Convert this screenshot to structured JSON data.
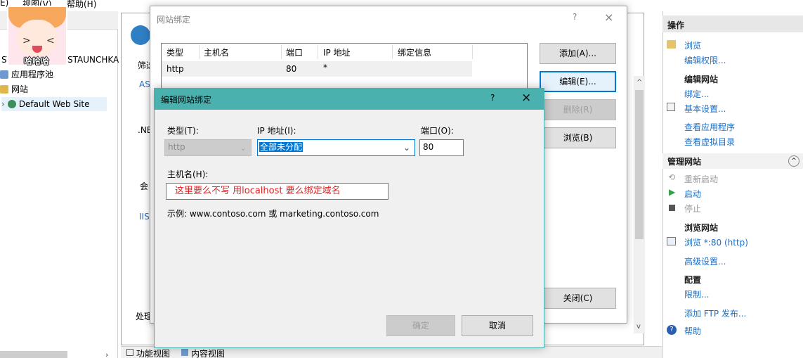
{
  "menubar": {
    "items": [
      "E)",
      "视图(V)",
      "帮助(H)"
    ]
  },
  "avatar": {
    "caption": "哈哈哈"
  },
  "tree": {
    "header_left": "ST",
    "header_right": "STAUNCHKA",
    "items": [
      {
        "label": "应用程序池"
      },
      {
        "label": "网站"
      },
      {
        "label": "Default Web Site"
      }
    ]
  },
  "center": {
    "tab_label": "筛选",
    "fragments": [
      "AS",
      ".NE",
      "会",
      "IIS",
      "处理"
    ],
    "bottom_tabs": [
      "功能视图",
      "内容视图"
    ]
  },
  "actions": {
    "title": "操作",
    "browse": "浏览",
    "edit_perms": "编辑权限...",
    "edit_site": "编辑网站",
    "bindings": "绑定...",
    "basic_settings": "基本设置...",
    "view_apps": "查看应用程序",
    "view_vdirs": "查看虚拟目录",
    "manage_site": "管理网站",
    "restart": "重新启动",
    "start": "启动",
    "stop": "停止",
    "browse_site": "浏览网站",
    "browse_80": "浏览 *:80 (http)",
    "advanced": "高级设置...",
    "config": "配置",
    "limits": "限制...",
    "add_ftp": "添加 FTP 发布...",
    "help": "帮助"
  },
  "site_bindings": {
    "title": "网站绑定",
    "help_glyph": "?",
    "close_glyph": "×",
    "columns": [
      "类型",
      "主机名",
      "端口",
      "IP 地址",
      "绑定信息"
    ],
    "rows": [
      {
        "type": "http",
        "host": "",
        "port": "80",
        "ip": "*",
        "info": ""
      }
    ],
    "buttons": {
      "add": "添加(A)...",
      "edit": "编辑(E)...",
      "remove": "删除(R)",
      "browse": "浏览(B)",
      "close": "关闭(C)"
    }
  },
  "edit_binding": {
    "title": "编辑网站绑定",
    "help_glyph": "?",
    "close_glyph": "×",
    "type_label": "类型(T):",
    "type_value": "http",
    "ip_label": "IP 地址(I):",
    "ip_value": "全部未分配",
    "port_label": "端口(O):",
    "port_value": "80",
    "host_label": "主机名(H):",
    "host_value": "这里要么不写 用localhost 要么绑定域名",
    "example": "示例: www.contoso.com 或 marketing.contoso.com",
    "ok": "确定",
    "cancel": "取消"
  },
  "colors": {
    "accent": "#4bb1ae",
    "link": "#1a6fc9",
    "focus": "#0078d7",
    "note": "#e02020"
  }
}
